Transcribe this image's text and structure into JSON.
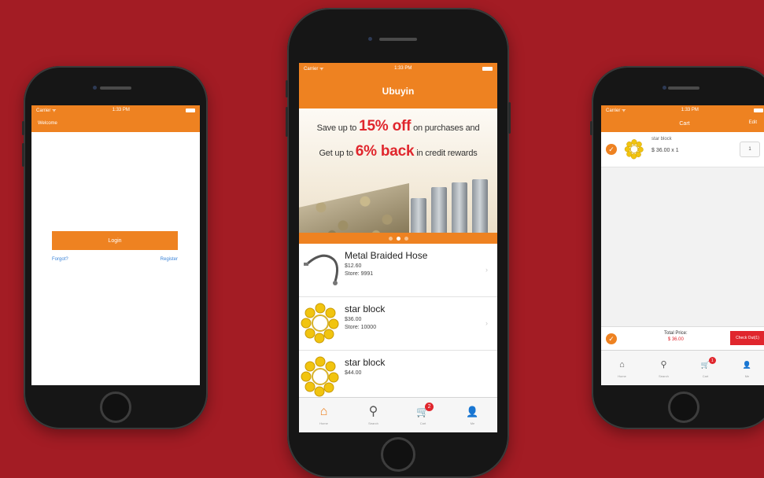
{
  "colors": {
    "background": "#a31c24",
    "accent": "#ee8221",
    "highlight_red": "#e0262d",
    "link_blue": "#3b84d8"
  },
  "login_screen": {
    "status_carrier": "Carrier ᯤ",
    "status_time": "1:33 PM",
    "nav_title": "Welcome",
    "login_button": "Login",
    "forgot_link": "Forgot?",
    "register_link": "Register"
  },
  "home_screen": {
    "status_carrier": "Carrier ᯤ",
    "status_time": "1:33 PM",
    "nav_title": "Ubuyin",
    "banner": {
      "line1_prefix": "Save up to ",
      "line1_highlight": "15% off",
      "line1_suffix": " on purchases and",
      "line2_prefix": "Get up to ",
      "line2_highlight": "6% back",
      "line2_suffix": " in credit rewards"
    },
    "products": [
      {
        "name": "Metal Braided Hose",
        "price": "$12.60",
        "store": "Store: 9991",
        "thumb": "hose-icon"
      },
      {
        "name": "star block",
        "price": "$36.00",
        "store": "Store: 10000",
        "thumb": "star-block-icon"
      },
      {
        "name": "star block",
        "price": "$44.00",
        "store": "",
        "thumb": "star-block-icon"
      }
    ],
    "tabs": [
      {
        "icon": "home-icon",
        "glyph": "⌂",
        "label": "Home"
      },
      {
        "icon": "search-icon",
        "glyph": "⚲",
        "label": "Search"
      },
      {
        "icon": "cart-icon",
        "glyph": "🛒",
        "label": "Cart",
        "badge": "2"
      },
      {
        "icon": "user-icon",
        "glyph": "👤",
        "label": "Me"
      }
    ]
  },
  "cart_screen": {
    "status_carrier": "Carrier ᯤ",
    "status_time": "1:33 PM",
    "nav_title": "Cart",
    "edit_label": "Edit",
    "item": {
      "name": "star block",
      "price_qty": "$ 36.00 x 1",
      "qty": "1"
    },
    "total_label": "Total Price:",
    "total_value": "$ 36.00",
    "checkout_button": "Check Out(1)",
    "tabs": [
      {
        "icon": "home-icon",
        "glyph": "⌂",
        "label": "Home"
      },
      {
        "icon": "search-icon",
        "glyph": "⚲",
        "label": "Search"
      },
      {
        "icon": "cart-icon",
        "glyph": "🛒",
        "label": "Cart",
        "badge": "1"
      },
      {
        "icon": "user-icon",
        "glyph": "👤",
        "label": "Me"
      }
    ]
  }
}
